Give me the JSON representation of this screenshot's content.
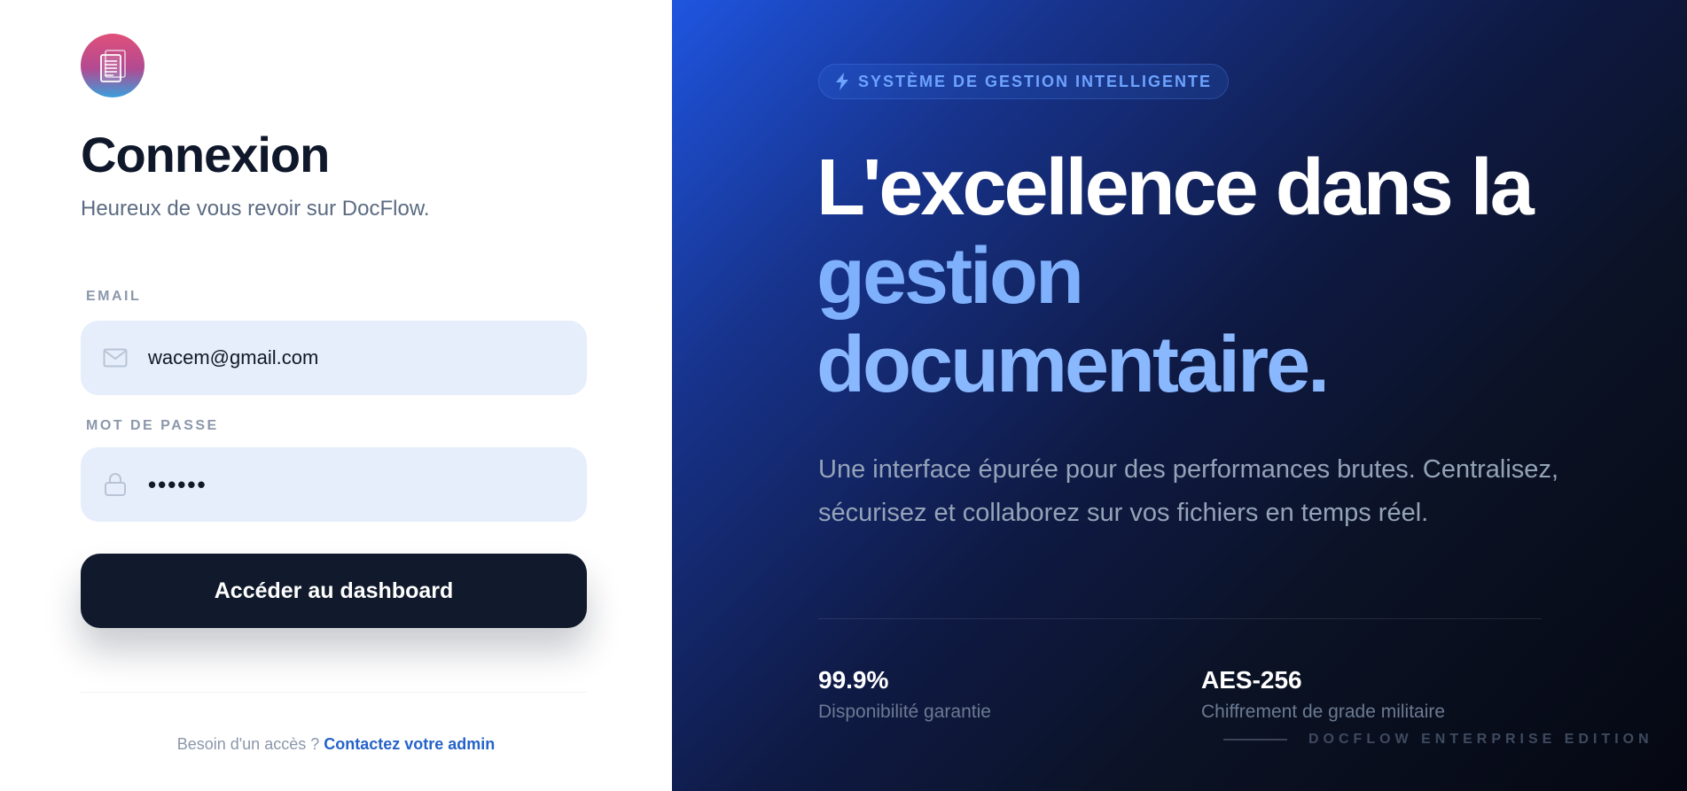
{
  "app": {
    "name": "DocFlow"
  },
  "login": {
    "title": "Connexion",
    "subtitle": "Heureux de vous revoir sur DocFlow.",
    "email": {
      "label": "EMAIL",
      "value": "wacem@gmail.com",
      "icon": "mail-icon"
    },
    "password": {
      "label": "MOT DE PASSE",
      "value": "••••••",
      "icon": "lock-icon"
    },
    "submit_label": "Accéder au dashboard",
    "footer": {
      "text": "Besoin d'un accès ?",
      "link": "Contactez votre admin"
    }
  },
  "hero": {
    "badge": "SYSTÈME DE GESTION INTELLIGENTE",
    "headline": {
      "line1": "L'excellence dans la",
      "line2": "gestion",
      "line3": "documentaire."
    },
    "description": "Une interface épurée pour des performances brutes. Centralisez, sécurisez et collaborez sur vos fichiers en temps réel.",
    "stats": [
      {
        "value": "99.9%",
        "label": "Disponibilité garantie"
      },
      {
        "value": "AES-256",
        "label": "Chiffrement de grade militaire"
      }
    ],
    "edition": "DOCFLOW ENTERPRISE EDITION"
  },
  "colors": {
    "accent": "#2563c9",
    "button": "#111a2c",
    "field_bg": "#e6eefb",
    "hero_highlight": "#8ab8ff"
  }
}
